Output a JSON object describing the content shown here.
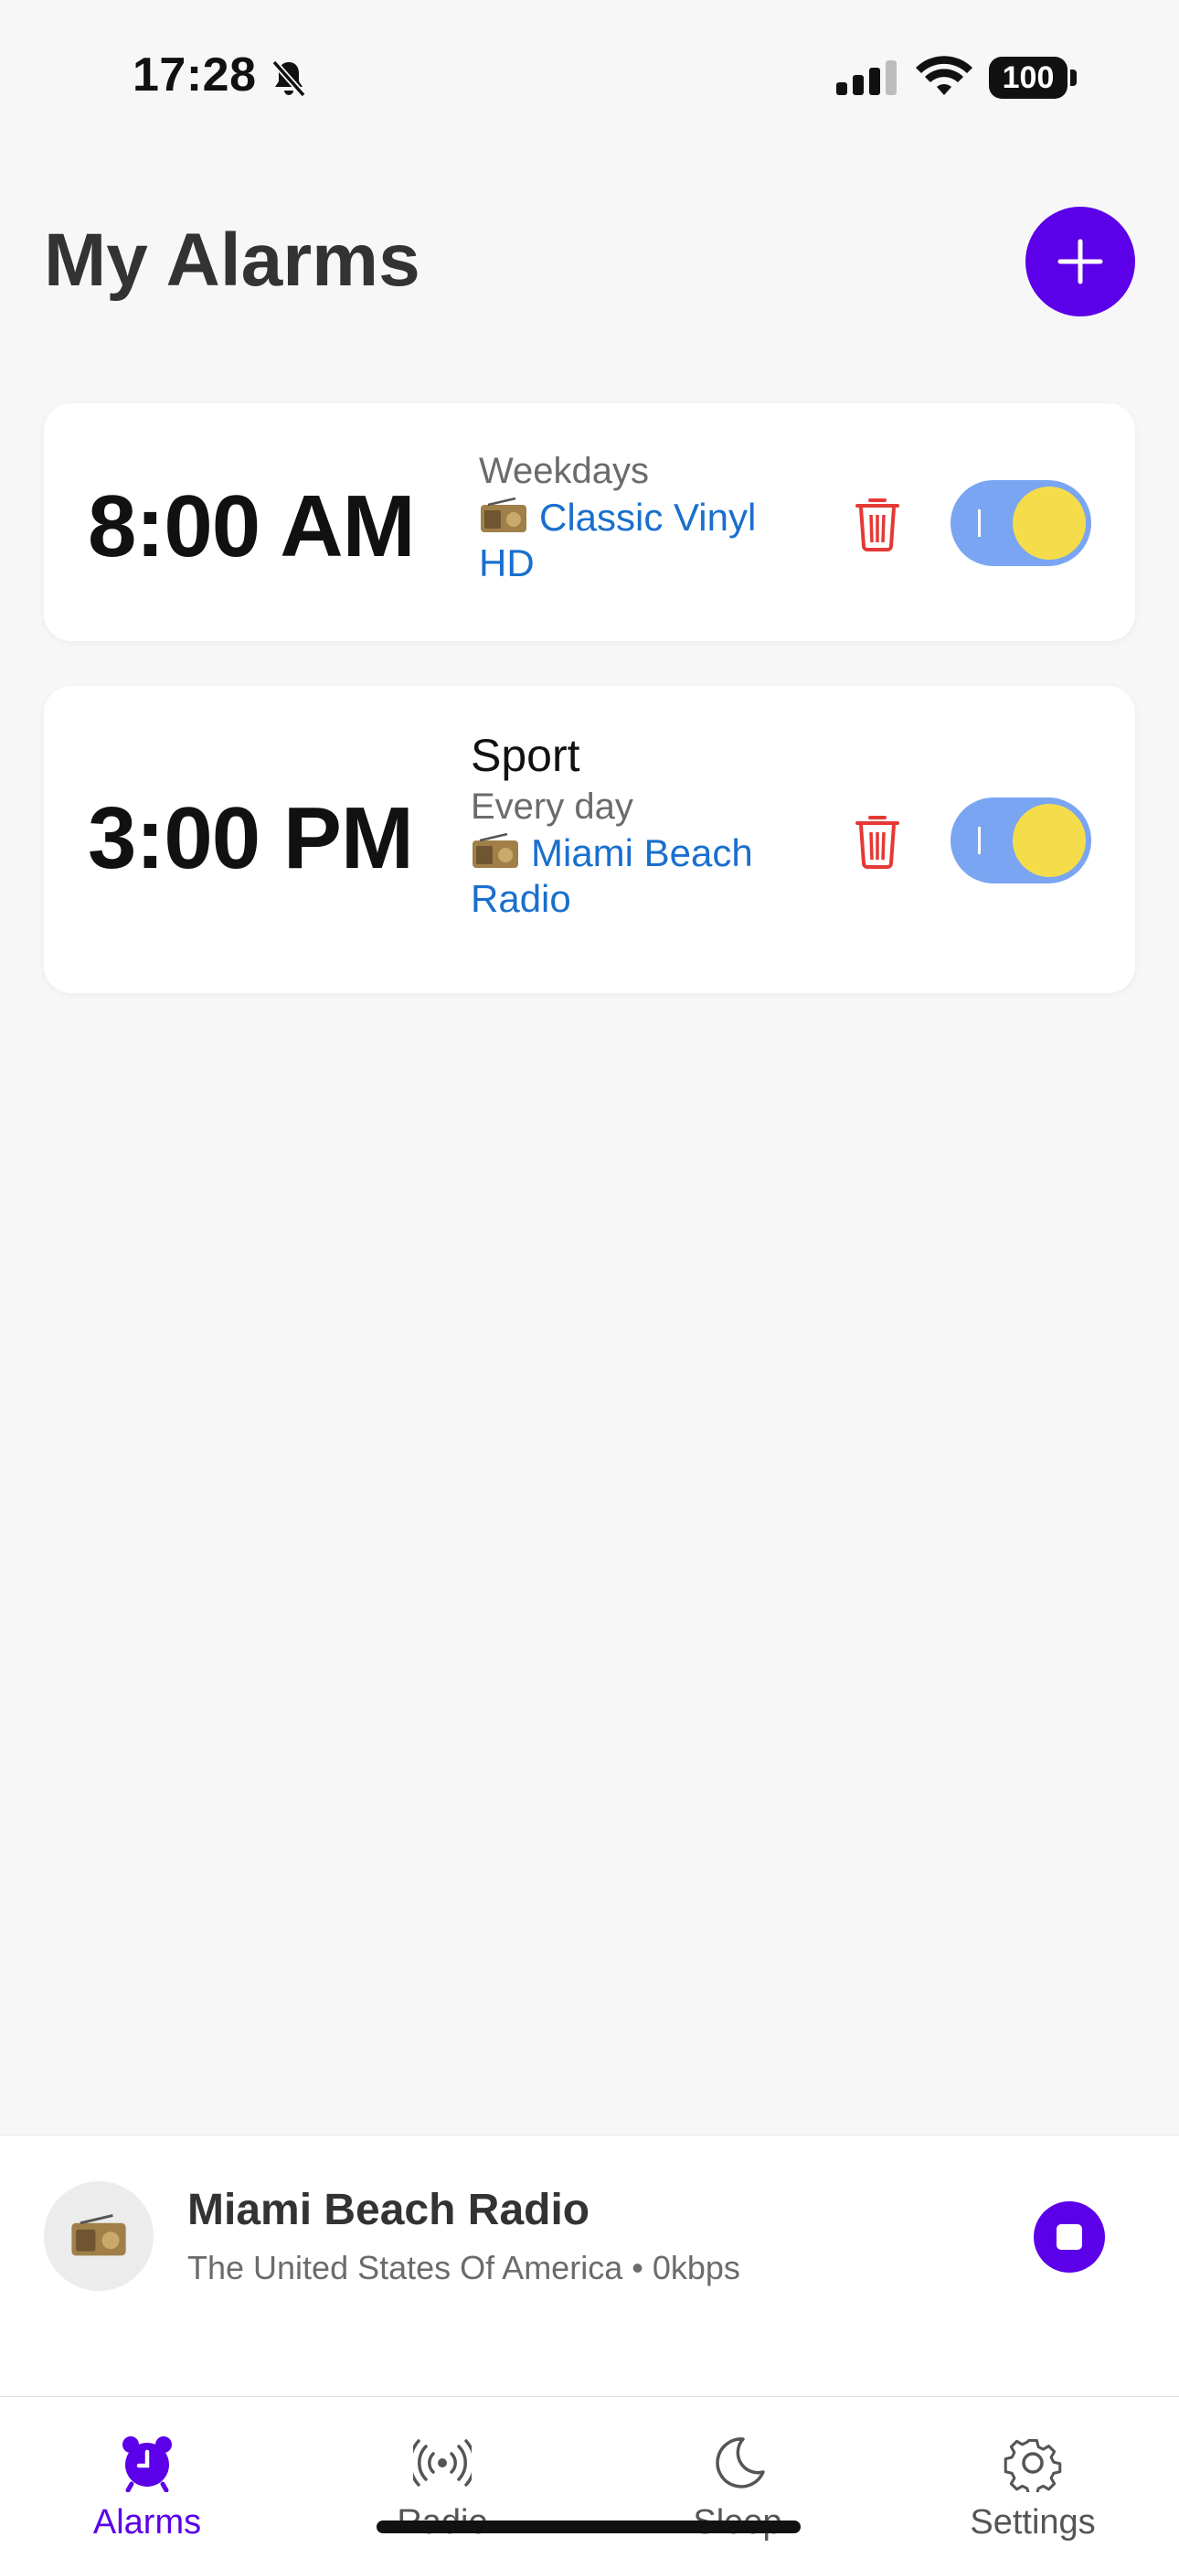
{
  "status_bar": {
    "time": "17:28",
    "battery": "100",
    "icons": [
      "bell-slash-icon",
      "cellular-signal-icon",
      "wifi-icon",
      "battery-icon"
    ]
  },
  "header": {
    "title": "My Alarms",
    "add_icon": "plus-icon"
  },
  "alarms": [
    {
      "time": "8:00 AM",
      "name": "",
      "days": "Weekdays",
      "station": "Classic Vinyl HD",
      "enabled": true
    },
    {
      "time": "3:00 PM",
      "name": "Sport",
      "days": "Every day",
      "station": "Miami Beach Radio",
      "enabled": true
    }
  ],
  "now_playing": {
    "title": "Miami Beach Radio",
    "subtitle": "The United States Of America • 0kbps"
  },
  "tabs": [
    {
      "label": "Alarms",
      "icon": "alarm-clock-icon",
      "active": true
    },
    {
      "label": "Radio",
      "icon": "broadcast-icon",
      "active": false
    },
    {
      "label": "Sleep",
      "icon": "moon-icon",
      "active": false
    },
    {
      "label": "Settings",
      "icon": "gear-icon",
      "active": false
    }
  ],
  "colors": {
    "accent": "#5b00e8",
    "station_link": "#1a6fce",
    "delete": "#e53935",
    "toggle_track": "#7aa5f2",
    "toggle_knob": "#f5dc4b"
  }
}
